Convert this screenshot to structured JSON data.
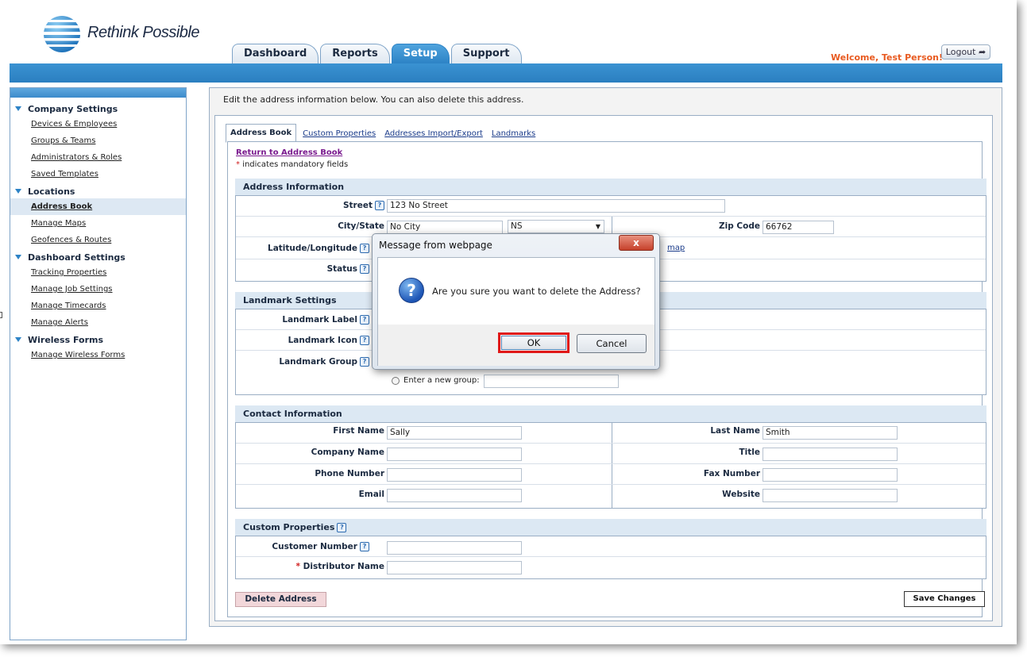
{
  "brand": {
    "name": "Rethink Possible"
  },
  "nav": {
    "tabs": [
      {
        "label": "Dashboard"
      },
      {
        "label": "Reports"
      },
      {
        "label": "Setup",
        "active": true
      },
      {
        "label": "Support"
      }
    ],
    "welcome": "Welcome, Test Person!",
    "logout": "Logout"
  },
  "sidebar": {
    "sections": [
      {
        "title": "Company Settings",
        "items": [
          "Devices & Employees",
          "Groups & Teams",
          "Administrators & Roles",
          "Saved Templates"
        ]
      },
      {
        "title": "Locations",
        "items": [
          "Address Book",
          "Manage Maps",
          "Geofences & Routes"
        ],
        "active": "Address Book"
      },
      {
        "title": "Dashboard Settings",
        "items": [
          "Tracking Properties",
          "Manage Job Settings",
          "Manage Timecards",
          "Manage Alerts"
        ]
      },
      {
        "title": "Wireless Forms",
        "items": [
          "Manage Wireless Forms"
        ]
      }
    ]
  },
  "main": {
    "intro": "Edit the address information below. You can also delete this address.",
    "subtabs": [
      {
        "label": "Address Book",
        "active": true
      },
      {
        "label": "Custom Properties"
      },
      {
        "label": "Addresses Import/Export"
      },
      {
        "label": "Landmarks"
      }
    ],
    "return_link": "Return to Address Book",
    "mandatory_star": "*",
    "mandatory_note": "indicates mandatory fields",
    "address": {
      "heading": "Address Information",
      "street_label": "Street",
      "street_value": "123 No Street",
      "citystate_label": "City/State",
      "city_value": "No City",
      "state_value": "NS",
      "zip_label": "Zip Code",
      "zip_value": "66762",
      "latlong_label": "Latitude/Longitude",
      "map_link_fragment": "map",
      "status_label": "Status"
    },
    "landmark": {
      "heading": "Landmark Settings",
      "label_label": "Landmark Label",
      "icon_label": "Landmark Icon",
      "group_label": "Landmark Group",
      "new_group_label": "Enter a new group:"
    },
    "contact": {
      "heading": "Contact Information",
      "first_name_label": "First Name",
      "first_name_value": "Sally",
      "last_name_label": "Last Name",
      "last_name_value": "Smith",
      "company_label": "Company Name",
      "title_label": "Title",
      "phone_label": "Phone Number",
      "fax_label": "Fax Number",
      "email_label": "Email",
      "website_label": "Website"
    },
    "custom": {
      "heading": "Custom Properties",
      "customer_number_label": "Customer Number",
      "distributor_star": "*",
      "distributor_label": "Distributor Name"
    },
    "delete_button": "Delete Address",
    "save_button": "Save Changes"
  },
  "dialog": {
    "title": "Message from webpage",
    "close_glyph": "x",
    "icon_glyph": "?",
    "message": "Are you sure you want to delete the Address?",
    "ok": "OK",
    "cancel": "Cancel"
  },
  "colors": {
    "accent_blue": "#2d83c6",
    "welcome_orange": "#e85a20",
    "highlight_red": "#e01818",
    "delete_pink": "#f2d7da"
  }
}
